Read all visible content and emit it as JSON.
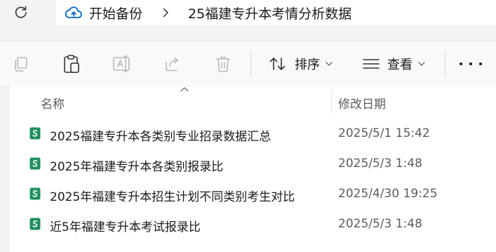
{
  "address_bar": {
    "breadcrumbs": [
      "开始备份",
      "25福建专升本考情分析数据"
    ],
    "refresh_icon": "refresh-icon",
    "cloud_icon": "cloud-backup-icon",
    "separator_icon": "chevron-right-icon"
  },
  "toolbar": {
    "copy_icon": "copy-icon",
    "paste_icon": "paste-icon",
    "rename_icon": "rename-icon",
    "share_icon": "share-icon",
    "delete_icon": "delete-icon",
    "sort_label": "排序",
    "view_label": "查看",
    "more_icon": "more-icon"
  },
  "columns": {
    "name": "名称",
    "date": "修改日期"
  },
  "files": [
    {
      "name": "2025福建专升本各类别专业招录数据汇总",
      "date": "2025/5/1 15:42"
    },
    {
      "name": "2025年福建专升本各类别报录比",
      "date": "2025/5/3 1:48"
    },
    {
      "name": "2025年福建专升本招生计划不同类别考生对比",
      "date": "2025/4/30 19:25"
    },
    {
      "name": "近5年福建专升本考试报录比",
      "date": "2025/5/3 1:48"
    }
  ],
  "colors": {
    "spreadsheet_icon": "#1f8f5f",
    "accent_blue": "#0067c0"
  }
}
